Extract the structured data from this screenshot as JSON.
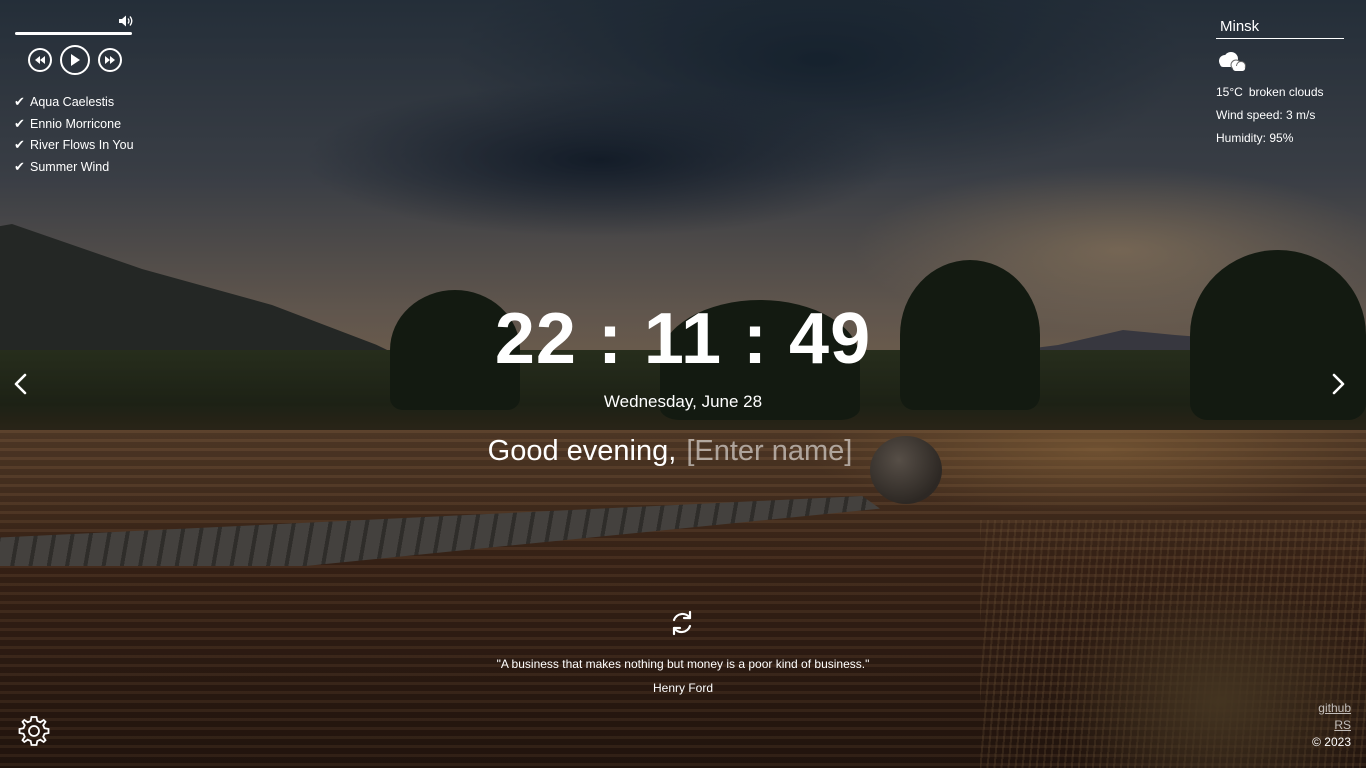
{
  "player": {
    "progress": 0.0,
    "playlist": [
      {
        "title": "Aqua Caelestis"
      },
      {
        "title": "Ennio Morricone"
      },
      {
        "title": "River Flows In You"
      },
      {
        "title": "Summer Wind"
      }
    ],
    "icons": {
      "volume": "volume-icon",
      "prev": "rewind-icon",
      "play": "play-icon",
      "next": "fast-forward-icon",
      "check": "check-icon"
    }
  },
  "weather": {
    "city": "Minsk",
    "icon": "broken-clouds-icon",
    "temperature": "15°C",
    "description": "broken clouds",
    "wind": "Wind speed: 3 m/s",
    "humidity": "Humidity: 95%"
  },
  "clock": {
    "time": "22 : 11 : 49",
    "date": "Wednesday, June 28"
  },
  "greeting": {
    "text": "Good evening,",
    "name_placeholder": "[Enter name]",
    "name_value": ""
  },
  "slider": {
    "prev_icon": "chevron-left-icon",
    "next_icon": "chevron-right-icon"
  },
  "quote": {
    "refresh_icon": "refresh-icon",
    "text": "\"A business that makes nothing but money is a poor kind of business.\"",
    "author": "Henry Ford"
  },
  "footer": {
    "github": "github",
    "rs": "RS",
    "copyright": "© 2023",
    "settings_icon": "gear-icon"
  },
  "colors": {
    "text": "#ffffff",
    "overlay": "#000000"
  }
}
